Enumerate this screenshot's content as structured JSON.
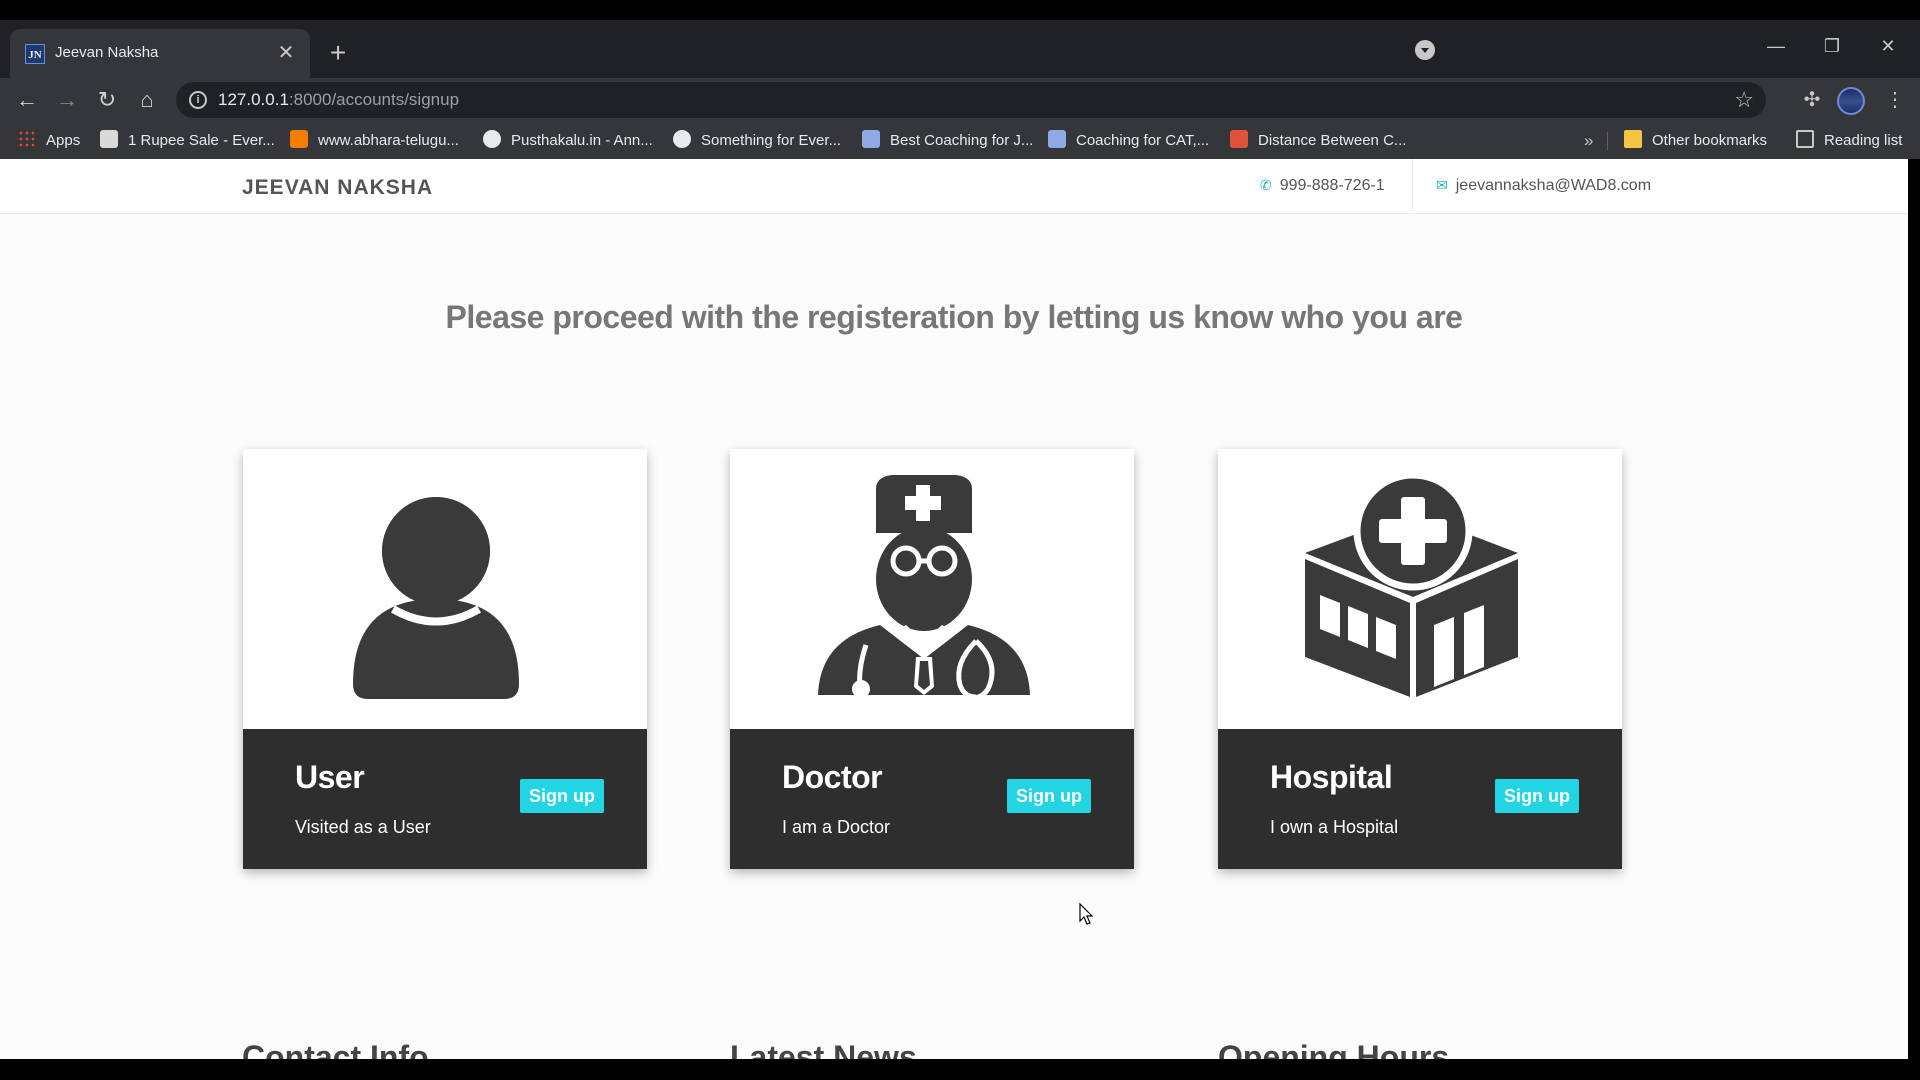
{
  "browser": {
    "tab": {
      "favicon": "JN",
      "title": "Jeevan Naksha",
      "close": "✕"
    },
    "new_tab": "+",
    "url_host": "127.0.0.1",
    "url_rest": ":8000/accounts/signup",
    "window_controls": [
      "—",
      "❐",
      "✕"
    ],
    "bookmarks": [
      "Apps",
      "1 Rupee Sale - Ever...",
      "www.abhara-telugu...",
      "Pusthakalu.in - Ann...",
      "Something for Ever...",
      "Best Coaching for J...",
      "Coaching for CAT,...",
      "Distance Between C..."
    ],
    "more_bookmarks": "»",
    "other_bookmarks": "Other bookmarks",
    "reading_list": "Reading list"
  },
  "site": {
    "brand": "JEEVAN NAKSHA",
    "phone": "999-888-726-1",
    "email": "jeevannaksha@WAD8.com",
    "heading": "Please proceed with the registeration by letting us know who you are",
    "cards": [
      {
        "title": "User",
        "desc": "Visited as a User",
        "button": "Sign up",
        "icon": "user-icon"
      },
      {
        "title": "Doctor",
        "desc": "I am a Doctor",
        "button": "Sign up",
        "icon": "doctor-icon"
      },
      {
        "title": "Hospital",
        "desc": "I own a Hospital",
        "button": "Sign up",
        "icon": "hospital-icon"
      }
    ],
    "footer_headings": [
      "Contact Info",
      "Latest News",
      "Opening Hours"
    ]
  },
  "colors": {
    "accent": "#23d5e3",
    "card_footer": "#2e2e2e",
    "icon": "#3a3a3a"
  }
}
